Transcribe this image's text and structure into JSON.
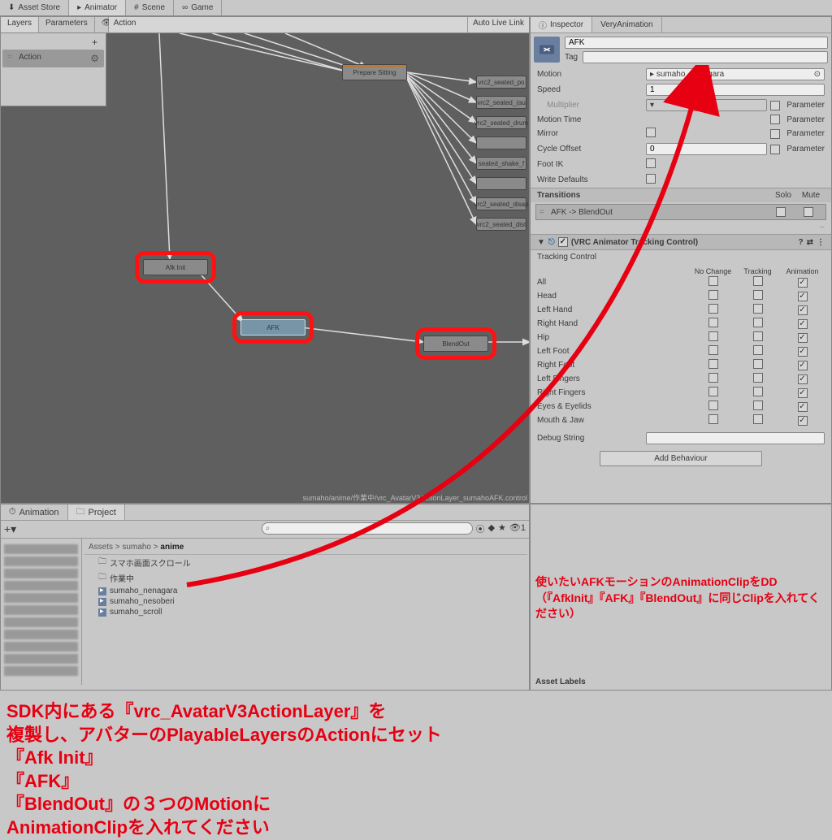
{
  "topTabs": {
    "assetStore": "Asset Store",
    "animator": "Animator",
    "scene": "Scene",
    "game": "Game"
  },
  "animatorToolbar": {
    "layers": "Layers",
    "parameters": "Parameters",
    "layerDropdown": "Action",
    "autoLiveLink": "Auto Live Link"
  },
  "animSidebar": {
    "actionLayer": "Action"
  },
  "nodes": {
    "prepareSitting": "Prepare Sitting",
    "seatedPo": "vrc2_seated_po",
    "seatedAu": "vrc2_seated_(au",
    "seatedDrum": "vrc2_seated_drum",
    "seatedF": "",
    "seatedShake": "seated_shake_f",
    "seatedF2": "",
    "seatedDisap": "vrc2_seated_disap",
    "seatedDist": "vrc2_seated_dist",
    "afkInit": "Afk Init",
    "afk": "AFK",
    "blendOut": "BlendOut"
  },
  "footerPath": "sumaho/anime/作業中/vrc_AvatarV3ActionLayer_sumahoAFK.control",
  "inspectorTabs": {
    "inspector": "Inspector",
    "veryAnimation": "VeryAnimation"
  },
  "inspectorHeader": {
    "name": "AFK",
    "tagLabel": "Tag"
  },
  "props": {
    "motionLabel": "Motion",
    "motionValue": "sumaho_nenagara",
    "speedLabel": "Speed",
    "speedValue": "1",
    "multiplierLabel": "Multiplier",
    "motionTimeLabel": "Motion Time",
    "mirrorLabel": "Mirror",
    "cycleOffsetLabel": "Cycle Offset",
    "cycleOffsetValue": "0",
    "footIKLabel": "Foot IK",
    "writeDefaultsLabel": "Write Defaults",
    "parameterLabel": "Parameter"
  },
  "transitions": {
    "header": "Transitions",
    "solo": "Solo",
    "mute": "Mute",
    "item": "AFK -> BlendOut"
  },
  "trackingControl": {
    "component": "(VRC Animator Tracking Control)",
    "sectionLabel": "Tracking Control",
    "cols": {
      "noChange": "No Change",
      "tracking": "Tracking",
      "animation": "Animation"
    },
    "rows": [
      "All",
      "Head",
      "Left Hand",
      "Right Hand",
      "Hip",
      "Left Foot",
      "Right Foot",
      "Left Fingers",
      "Right Fingers",
      "Eyes & Eyelids",
      "Mouth & Jaw"
    ],
    "debugStringLabel": "Debug String"
  },
  "addBehaviour": "Add Behaviour",
  "lowerTabs": {
    "animation": "Animation",
    "project": "Project"
  },
  "breadcrumb": {
    "p1": "Assets",
    "p2": "sumaho",
    "p3": "anime"
  },
  "assets": {
    "folder1": "スマホ画面スクロール",
    "folder2": "作業中",
    "clip1": "sumaho_nenagara",
    "clip2": "sumaho_nesoberi",
    "clip3": "sumaho_scroll"
  },
  "assetLabels": "Asset Labels",
  "annotations": {
    "ddLine1": "使いたいAFKモーションのAnimationClipをDD",
    "ddLine2": "（『AfkInit』『AFK』『BlendOut』に同じClipを入れてください）",
    "big1": "SDK内にある『vrc_AvatarV3ActionLayer』を",
    "big2": "複製し、アバターのPlayableLayersのActionにセット",
    "big3": "『Afk Init』",
    "big4": "『AFK』",
    "big5": "『BlendOut』の３つのMotionに",
    "big6": "AnimationClipを入れてください"
  }
}
